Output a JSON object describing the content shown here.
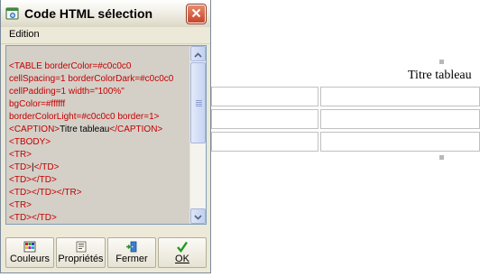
{
  "dialog": {
    "title": "Code HTML sélection",
    "menu": {
      "edition": "Edition"
    },
    "code_lines": [
      {
        "tag": "<TABLE borderColor=#c0c0c0",
        "text": "",
        "end": ""
      },
      {
        "tag": "cellSpacing=1 borderColorDark=#c0c0c0",
        "text": "",
        "end": ""
      },
      {
        "tag": "cellPadding=1 width=\"100%\"",
        "text": "",
        "end": ""
      },
      {
        "tag": "bgColor=#ffffff",
        "text": "",
        "end": ""
      },
      {
        "tag": "borderColorLight=#c0c0c0 border=1>",
        "text": "",
        "end": ""
      },
      {
        "tag": "<CAPTION>",
        "text": "Titre tableau",
        "end": "</CAPTION>"
      },
      {
        "tag": "<TBODY>",
        "text": "",
        "end": ""
      },
      {
        "tag": "<TR>",
        "text": "",
        "end": ""
      },
      {
        "tag": "<TD>",
        "text": "|",
        "end": "</TD>"
      },
      {
        "tag": "<TD></TD>",
        "text": "",
        "end": ""
      },
      {
        "tag": "<TD></TD></TR>",
        "text": "",
        "end": ""
      },
      {
        "tag": "<TR>",
        "text": "",
        "end": ""
      },
      {
        "tag": "<TD></TD>",
        "text": "",
        "end": ""
      }
    ],
    "buttons": {
      "couleurs": "Couleurs",
      "proprietes": "Propriétés",
      "fermer": "Fermer",
      "ok": "OK"
    }
  },
  "editor": {
    "table_caption": "Titre tableau"
  },
  "icons": {
    "app": "html-code-icon",
    "close": "close-icon",
    "scroll_up": "arrow-up-icon",
    "scroll_down": "arrow-down-icon",
    "couleurs": "palette-icon",
    "proprietes": "properties-icon",
    "fermer": "exit-door-icon",
    "ok": "checkmark-icon"
  },
  "colors": {
    "code_tag": "#c40000",
    "code_text": "#000000",
    "table_border": "#c0c0c0",
    "dialog_bg": "#ece9d8",
    "code_bg": "#d4d0c8"
  }
}
